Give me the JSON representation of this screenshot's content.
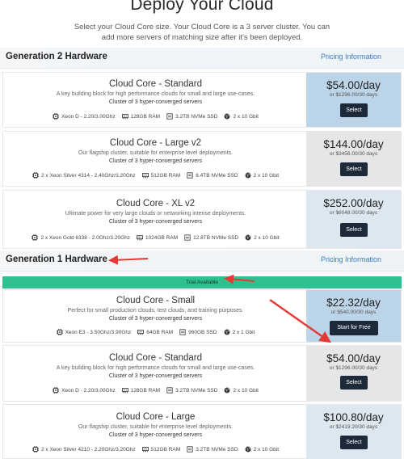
{
  "page": {
    "title": "Deploy Your Cloud",
    "subtitle": "Select your Cloud Core size. Your Cloud Core is a 3 server cluster. You can add more servers of matching size after it's been deployed."
  },
  "colors": {
    "accent_link": "#3b7fc4",
    "button": "#1d2a3a",
    "trial_bar": "#2ec08e",
    "annotation_arrow": "#e53935",
    "price_panel_highlight": "#bcd4e8"
  },
  "generations": [
    {
      "title": "Generation 2 Hardware",
      "pricing_link": "Pricing Information",
      "plans": [
        {
          "name": "Cloud Core - Standard",
          "description": "A key building block for high performance clouds for small and large use-cases.",
          "cluster": "Cluster of 3 hyper-converged servers",
          "cpu": "Xeon D - 2.20/3.00Ghz",
          "ram": "128GB RAM",
          "storage": "3.2TB NVMe SSD",
          "network": "2 x 10 Gbit",
          "price": "$54.00/day",
          "price_alt": "or $1296.00/30 days",
          "button": "Select"
        },
        {
          "name": "Cloud Core - Large v2",
          "description": "Our flagship cluster, suitable for enterprise level deployments.",
          "cluster": "Cluster of 3 hyper-converged servers",
          "cpu": "2 x Xeon Silver 4314 - 2.40Ghz/3.20Ghz",
          "ram": "512GB RAM",
          "storage": "6.4TB NVMe SSD",
          "network": "2 x 10 Gbit",
          "price": "$144.00/day",
          "price_alt": "or $3456.00/30 days",
          "button": "Select"
        },
        {
          "name": "Cloud Core - XL v2",
          "description": "Ultimate power for very large clouds or networking intense deployments.",
          "cluster": "Cluster of 3 hyper-converged servers",
          "cpu": "2 x Xeon Gold 6338 - 2.0Ghz/3.20Ghz",
          "ram": "1024GB RAM",
          "storage": "12.8TB NVMe SSD",
          "network": "2 x 10 Gbit",
          "price": "$252.00/day",
          "price_alt": "or $6048.00/30 days",
          "button": "Select"
        }
      ]
    },
    {
      "title": "Generation 1 Hardware",
      "pricing_link": "Pricing Information",
      "trial_label": "Trial Available",
      "plans": [
        {
          "name": "Cloud Core - Small",
          "description": "Perfect for small production clouds, test clouds, and training purposes.",
          "cluster": "Cluster of 3 hyper-converged servers",
          "cpu": "Xeon E3 - 3.50Ghz/3.90Ghz",
          "ram": "64GB RAM",
          "storage": "960GB SSD",
          "network": "2 x 1 Gbit",
          "price": "$22.32/day",
          "price_alt": "or $540.00/30 days",
          "button": "Start for Free"
        },
        {
          "name": "Cloud Core - Standard",
          "description": "A key building block for high performance clouds for small and large use-cases.",
          "cluster": "Cluster of 3 hyper-converged servers",
          "cpu": "Xeon D - 2.20/3.00Ghz",
          "ram": "128GB RAM",
          "storage": "3.2TB NVMe SSD",
          "network": "2 x 10 Gbit",
          "price": "$54.00/day",
          "price_alt": "or $1296.00/30 days",
          "button": "Select"
        },
        {
          "name": "Cloud Core - Large",
          "description": "Our flagship cluster, suitable for enterprise level deployments.",
          "cluster": "Cluster of 3 hyper-converged servers",
          "cpu": "2 x Xeon Silver 4210 - 2.20Ghz/3.20Ghz",
          "ram": "512GB RAM",
          "storage": "3.2TB NVMe SSD",
          "network": "2 x 10 Gbit",
          "price": "$100.80/day",
          "price_alt": "or $2419.20/30 days",
          "button": "Select"
        }
      ]
    }
  ],
  "icons": {
    "cpu": "cpu-chip-icon",
    "ram": "memory-icon",
    "storage": "ssd-drive-icon",
    "network": "globe-icon"
  }
}
